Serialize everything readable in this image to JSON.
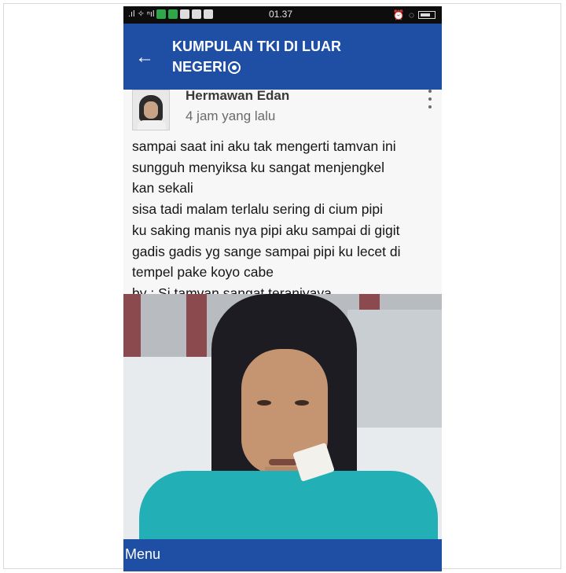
{
  "status_bar": {
    "carrier_indicators": ".ıl ✧ ⁿıl",
    "time": "01.37"
  },
  "header": {
    "back_icon": "arrow-left-icon",
    "title_line1": "KUMPULAN TKI DI LUAR",
    "title_line2": "NEGERI"
  },
  "post": {
    "author": "Hermawan Edan",
    "time": "4 jam yang lalu",
    "lines": [
      "sampai saat ini aku tak mengerti tamvan ini",
      "sungguh menyiksa ku sangat menjengkel",
      "kan sekali",
      "sisa tadi malam terlalu sering di cium pipi",
      "ku saking manis nya  pipi aku sampai di gigit",
      "gadis gadis yg sange sampai pipi ku lecet di",
      "tempel  pake koyo cabe",
      "by : Si tamvan sangat teraniyaya"
    ]
  },
  "bottom_bar": {
    "menu_label": "Menu"
  },
  "colors": {
    "header_blue": "#1f4fa5",
    "status_black": "#0d0d0d",
    "background": "#f7f7f7"
  }
}
